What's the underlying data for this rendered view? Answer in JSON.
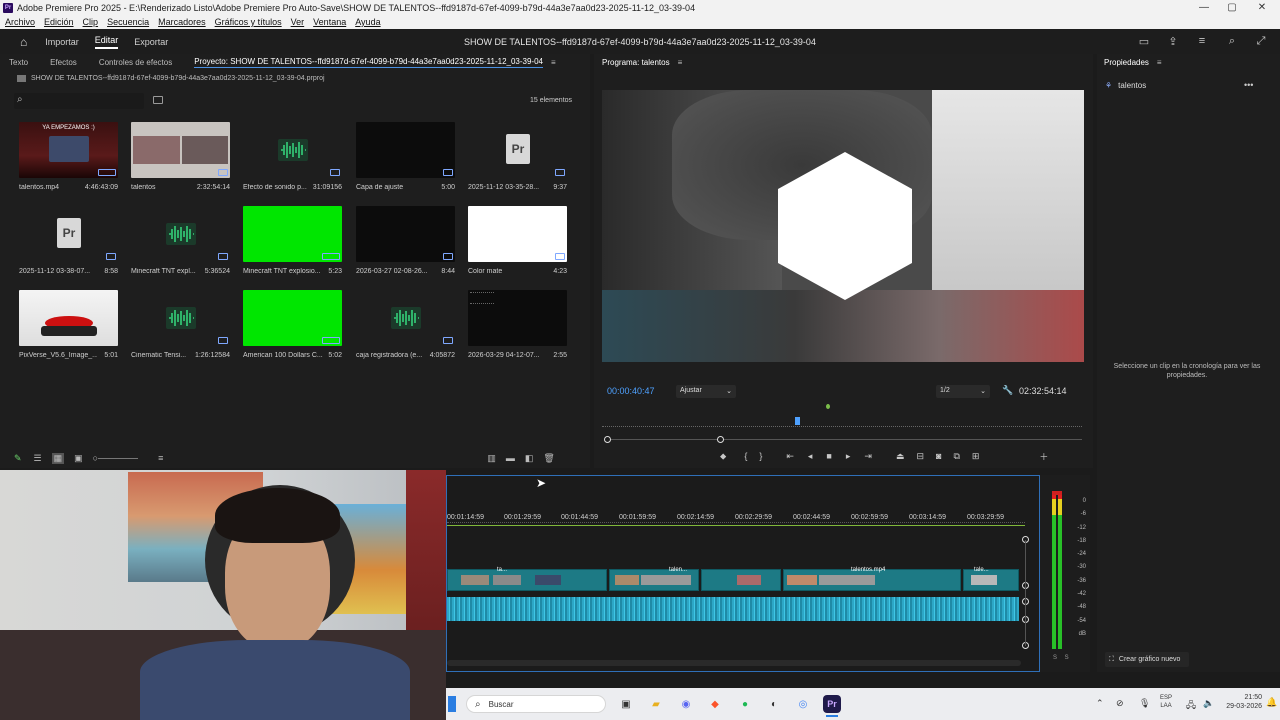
{
  "window": {
    "title": "Adobe Premiere Pro 2025 - E:\\Renderizado Listo\\Adobe Premiere Pro Auto-Save\\SHOW DE TALENTOS--ffd9187d-67ef-4099-b79d-44a3e7aa0d23-2025-11-12_03-39-04",
    "app_badge": "Pr",
    "minimize": "—",
    "maximize": "▢",
    "close": "✕"
  },
  "menu": [
    "Archivo",
    "Edición",
    "Clip",
    "Secuencia",
    "Marcadores",
    "Gráficos y títulos",
    "Ver",
    "Ventana",
    "Ayuda"
  ],
  "workspace": {
    "tabs": [
      {
        "label": "Importar"
      },
      {
        "label": "Editar"
      },
      {
        "label": "Exportar"
      }
    ],
    "project_title": "SHOW DE TALENTOS--ffd9187d-67ef-4099-b79d-44a3e7aa0d23-2025-11-12_03-39-04"
  },
  "project_panel": {
    "tabs": [
      "Texto",
      "Efectos",
      "Controles de efectos",
      "Proyecto: SHOW DE TALENTOS--ffd9187d-67ef-4099-b79d-44a3e7aa0d23-2025-11-12_03-39-04"
    ],
    "file": "SHOW DE TALENTOS--ffd9187d-67ef-4099-b79d-44a3e7aa0d23-2025-11-12_03-39-04.prproj",
    "search_placeholder": "",
    "count": "15 elementos",
    "items": [
      {
        "name": "talentos.mp4",
        "duration": "4:46:43:09",
        "type": "video-stream"
      },
      {
        "name": "talentos",
        "duration": "2:32:54:14",
        "type": "video-call"
      },
      {
        "name": "Efecto de sonido p...",
        "duration": "31:09156",
        "type": "audio"
      },
      {
        "name": "Capa de ajuste",
        "duration": "5:00",
        "type": "black"
      },
      {
        "name": "2025-11-12 03-35-28...",
        "duration": "9:37",
        "type": "project"
      },
      {
        "name": "2025-11-12 03-38-07...",
        "duration": "8:58",
        "type": "project"
      },
      {
        "name": "Minecraft TNT expl...",
        "duration": "5:36524",
        "type": "audio"
      },
      {
        "name": "Minecraft TNT explosio...",
        "duration": "5:23",
        "type": "green"
      },
      {
        "name": "2026-03-27 02-08-26...",
        "duration": "8:44",
        "type": "black"
      },
      {
        "name": "Color mate",
        "duration": "4:23",
        "type": "white"
      },
      {
        "name": "PixVerse_V5.6_Image_...",
        "duration": "5:01",
        "type": "button"
      },
      {
        "name": "Cinematic Tensi...",
        "duration": "1:26:12584",
        "type": "audio"
      },
      {
        "name": "American 100 Dollars C...",
        "duration": "5:02",
        "type": "green"
      },
      {
        "name": "caja registradora (e...",
        "duration": "4:05872",
        "type": "audio"
      },
      {
        "name": "2026-03-29 04-12-07...",
        "duration": "2:55",
        "type": "screen"
      }
    ],
    "stream_overlay": "YA EMPEZAMOS :)"
  },
  "program_monitor": {
    "title": "Programa: talentos",
    "timecode": "00:00:40:47",
    "fit": "Ajustar",
    "resolution": "1/2",
    "duration": "02:32:54:14"
  },
  "properties": {
    "title": "Propiedades",
    "clip": "talentos",
    "empty_msg": "Seleccione un clip en la cronología para ver las propiedades.",
    "new_graphic": "Crear gráfico nuevo"
  },
  "timeline": {
    "ruler": [
      "00:01:14:59",
      "00:01:29:59",
      "00:01:44:59",
      "00:01:59:59",
      "00:02:14:59",
      "00:02:29:59",
      "00:02:44:59",
      "00:02:59:59",
      "00:03:14:59",
      "00:03:29:59"
    ],
    "clip_labels": [
      "ta...",
      "talen...",
      "talentos.mp4",
      "tale..."
    ]
  },
  "vumeter": {
    "scale": [
      "0",
      "-6",
      "-12",
      "-18",
      "-24",
      "-30",
      "-36",
      "-42",
      "-48",
      "-54",
      "dB"
    ],
    "channels": "S S"
  },
  "taskbar": {
    "search": "Buscar",
    "lang_top": "ESP",
    "lang_bottom": "LAA",
    "time": "21:50",
    "date": "29-03-2026"
  },
  "colors": {
    "accent": "#4a90e2",
    "timecode": "#4ea1ff",
    "green_screen": "#00e600",
    "clip_video": "#1d7a85",
    "clip_audio": "#2da7c6"
  }
}
